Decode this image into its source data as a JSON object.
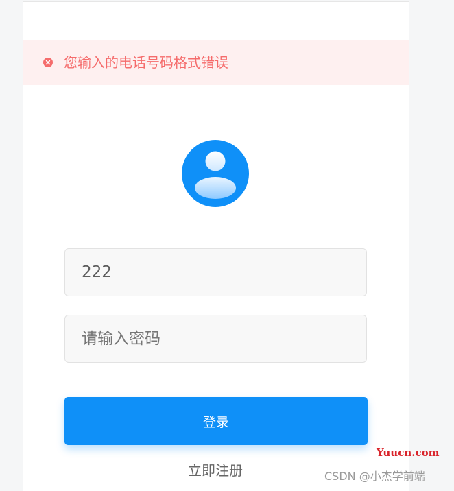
{
  "toast": {
    "icon": "error-circle-icon",
    "message": "您输入的电话号码格式错误",
    "color": "#f56c6c",
    "background": "#fef0f0"
  },
  "avatar": {
    "icon": "user-avatar-icon",
    "color": "#0f90f8"
  },
  "form": {
    "phone_value": "222",
    "password_placeholder": "请输入密码",
    "login_label": "登录",
    "register_label": "立即注册"
  },
  "watermark": {
    "site": "Yuucn.com",
    "csdn": "CSDN @小杰学前端"
  },
  "colors": {
    "primary": "#0f90f8",
    "error": "#f56c6c"
  }
}
